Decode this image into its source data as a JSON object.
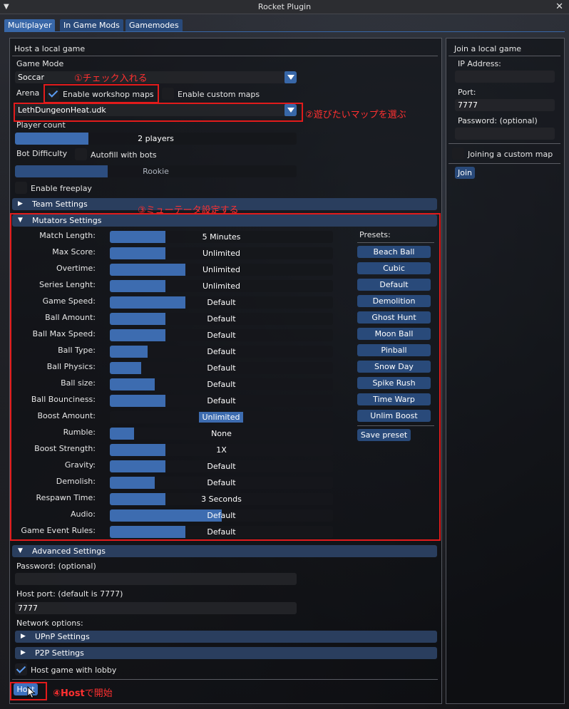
{
  "window": {
    "title": "Rocket Plugin",
    "collapse_icon": "triangle-down-icon",
    "close_icon": "close-icon"
  },
  "tabs": [
    "Multiplayer",
    "In Game Mods",
    "Gamemodes"
  ],
  "host": {
    "title": "Host a local game",
    "game_mode_label": "Game Mode",
    "game_mode_value": "Soccar",
    "arena_label": "Arena",
    "enable_workshop_maps": "Enable workshop maps",
    "enable_custom_maps": "Enable custom maps",
    "map_value": "LethDungeonHeat.udk",
    "player_count_label": "Player count",
    "player_count_value": "2 players",
    "player_count_fraction": 0.26,
    "bot_difficulty_label": "Bot Difficulty",
    "autofill_bots": "Autofill with bots",
    "bot_difficulty_value": "Rookie",
    "bot_difficulty_fraction": 0.33,
    "enable_freeplay": "Enable freeplay",
    "team_settings": "Team Settings",
    "mutators_settings": "Mutators Settings",
    "advanced_settings": "Advanced Settings",
    "password_label": "Password: (optional)",
    "host_port_label": "Host port: (default is 7777)",
    "host_port_value": "7777",
    "network_options_label": "Network options:",
    "upnp_settings": "UPnP Settings",
    "p2p_settings": "P2P Settings",
    "host_with_lobby": "Host game with lobby",
    "host_button": "Host"
  },
  "mutators": [
    {
      "label": "Match Length:",
      "value": "5 Minutes",
      "fraction": 0.25
    },
    {
      "label": "Max Score:",
      "value": "Unlimited",
      "fraction": 0.25
    },
    {
      "label": "Overtime:",
      "value": "Unlimited",
      "fraction": 0.34
    },
    {
      "label": "Series Lenght:",
      "value": "Unlimited",
      "fraction": 0.25
    },
    {
      "label": "Game Speed:",
      "value": "Default",
      "fraction": 0.34
    },
    {
      "label": "Ball Amount:",
      "value": "Default",
      "fraction": 0.25
    },
    {
      "label": "Ball Max Speed:",
      "value": "Default",
      "fraction": 0.25
    },
    {
      "label": "Ball Type:",
      "value": "Default",
      "fraction": 0.17
    },
    {
      "label": "Ball Physics:",
      "value": "Default",
      "fraction": 0.14
    },
    {
      "label": "Ball size:",
      "value": "Default",
      "fraction": 0.2
    },
    {
      "label": "Ball Bounciness:",
      "value": "Default",
      "fraction": 0.25
    },
    {
      "label": "Boost Amount:",
      "value": "Unlimited",
      "fraction": 0
    },
    {
      "label": "Rumble:",
      "value": "None",
      "fraction": 0.11
    },
    {
      "label": "Boost Strength:",
      "value": "1X",
      "fraction": 0.25
    },
    {
      "label": "Gravity:",
      "value": "Default",
      "fraction": 0.25
    },
    {
      "label": "Demolish:",
      "value": "Default",
      "fraction": 0.2
    },
    {
      "label": "Respawn Time:",
      "value": "3 Seconds",
      "fraction": 0.25
    },
    {
      "label": "Audio:",
      "value": "Default",
      "fraction": 0.5
    },
    {
      "label": "Game Event Rules:",
      "value": "Default",
      "fraction": 0.34
    }
  ],
  "presets": {
    "label": "Presets:",
    "items": [
      "Beach Ball",
      "Cubic",
      "Default",
      "Demolition",
      "Ghost Hunt",
      "Moon Ball",
      "Pinball",
      "Snow Day",
      "Spike Rush",
      "Time Warp",
      "Unlim Boost"
    ],
    "save_button": "Save preset"
  },
  "join": {
    "title": "Join a local game",
    "ip_label": "IP Address:",
    "ip_value": "",
    "port_label": "Port:",
    "port_value": "7777",
    "password_label": "Password: (optional)",
    "joining_custom_map": "Joining a custom map",
    "join_button": "Join"
  },
  "annotations": {
    "step1": "①チェック入れる",
    "step2": "②遊びたいマップを選ぶ",
    "step3": "③ミューテータ設定する",
    "step4_strong": "④Host",
    "step4_rest": "で開始"
  },
  "colors": {
    "accent": "#3867a8",
    "annotation": "#e21b1b"
  }
}
